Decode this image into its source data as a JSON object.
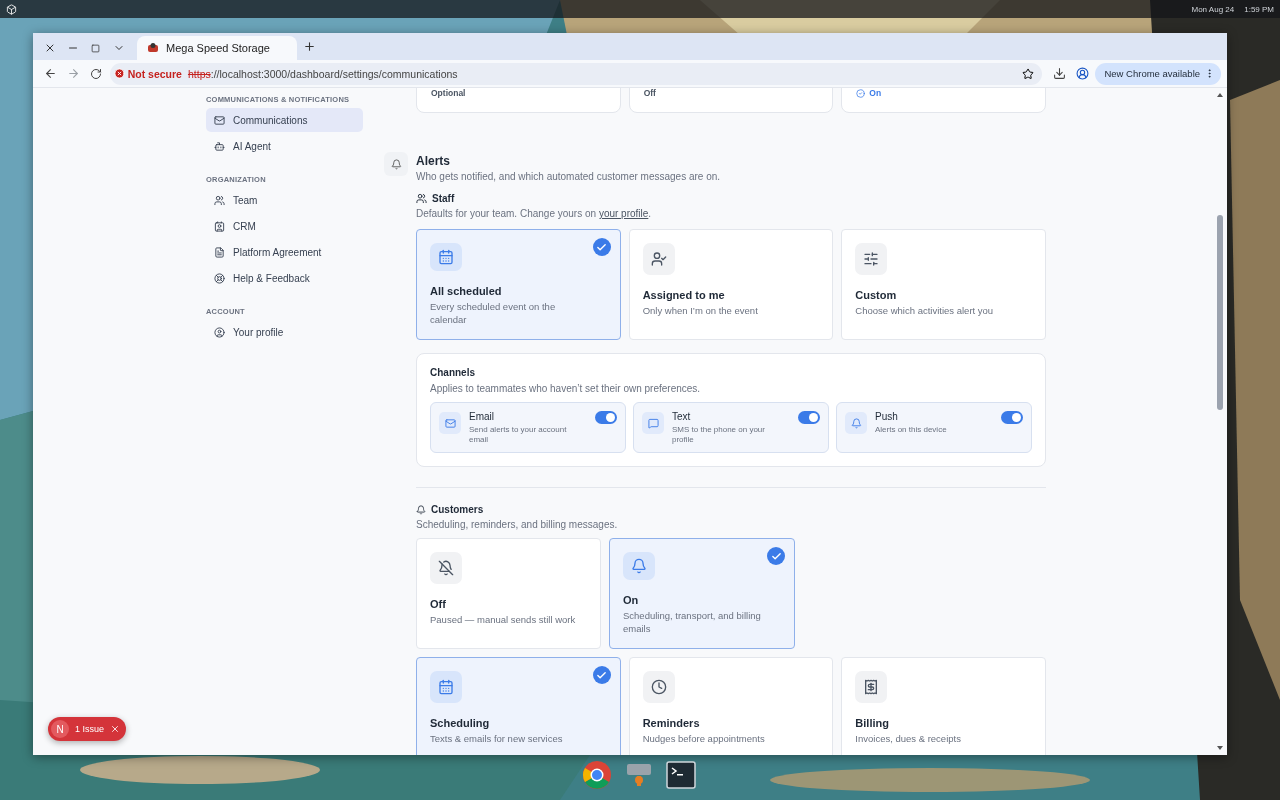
{
  "system_bar": {
    "date": "Mon Aug 24",
    "time": "1:59 PM"
  },
  "browser": {
    "tabs": [
      {
        "title": "Mega Speed Storage",
        "selected": true
      }
    ],
    "address": {
      "security": "Not secure",
      "scheme": "https",
      "rest": "://localhost:3000/dashboard/settings/communications"
    },
    "update_button": "New Chrome available"
  },
  "sidebar": [
    {
      "heading": "COMMUNICATIONS & NOTIFICATIONS",
      "items": [
        {
          "label": "Communications",
          "selected": true
        },
        {
          "label": "AI Agent",
          "selected": false
        }
      ]
    },
    {
      "heading": "ORGANIZATION",
      "items": [
        {
          "label": "Team",
          "selected": false
        },
        {
          "label": "CRM",
          "selected": false
        },
        {
          "label": "Platform Agreement",
          "selected": false
        },
        {
          "label": "Help & Feedback",
          "selected": false
        }
      ]
    },
    {
      "heading": "ACCOUNT",
      "items": [
        {
          "label": "Your profile",
          "selected": false
        }
      ]
    }
  ],
  "previous_options": [
    {
      "label": "Optional",
      "selected": false
    },
    {
      "label": "Off",
      "selected": false
    },
    {
      "label": "On",
      "selected": true
    }
  ],
  "alerts": {
    "title": "Alerts",
    "subtitle": "Who gets notified, and which automated customer messages are on.",
    "staff": {
      "title": "Staff",
      "text_before": "Defaults for your team. Change yours on ",
      "link": "your profile",
      "text_after": "."
    },
    "staff_options": [
      {
        "title": "All scheduled",
        "description": "Every scheduled event on the calendar",
        "selected": true
      },
      {
        "title": "Assigned to me",
        "description": "Only when I’m on the event",
        "selected": false
      },
      {
        "title": "Custom",
        "description": "Choose which activities alert you",
        "selected": false
      }
    ],
    "channels": {
      "title": "Channels",
      "description": "Applies to teammates who haven’t set their own preferences.",
      "items": [
        {
          "name": "Email",
          "description": "Send alerts to your account email",
          "on": true
        },
        {
          "name": "Text",
          "description": "SMS to the phone on your profile",
          "on": true
        },
        {
          "name": "Push",
          "description": "Alerts on this device",
          "on": true
        }
      ]
    },
    "customers": {
      "title": "Customers",
      "description": "Scheduling, reminders, and billing messages.",
      "modes": [
        {
          "title": "Off",
          "description": "Paused — manual sends still work",
          "selected": false
        },
        {
          "title": "On",
          "description": "Scheduling, transport, and billing emails",
          "selected": true
        }
      ],
      "categories": [
        {
          "title": "Scheduling",
          "description": "Texts & emails for new services",
          "selected": true
        },
        {
          "title": "Reminders",
          "description": "Nudges before appointments",
          "selected": false
        },
        {
          "title": "Billing",
          "description": "Invoices, dues & receipts",
          "selected": false
        }
      ]
    }
  },
  "issue_badge": {
    "avatar": "N",
    "label": "1 Issue"
  }
}
